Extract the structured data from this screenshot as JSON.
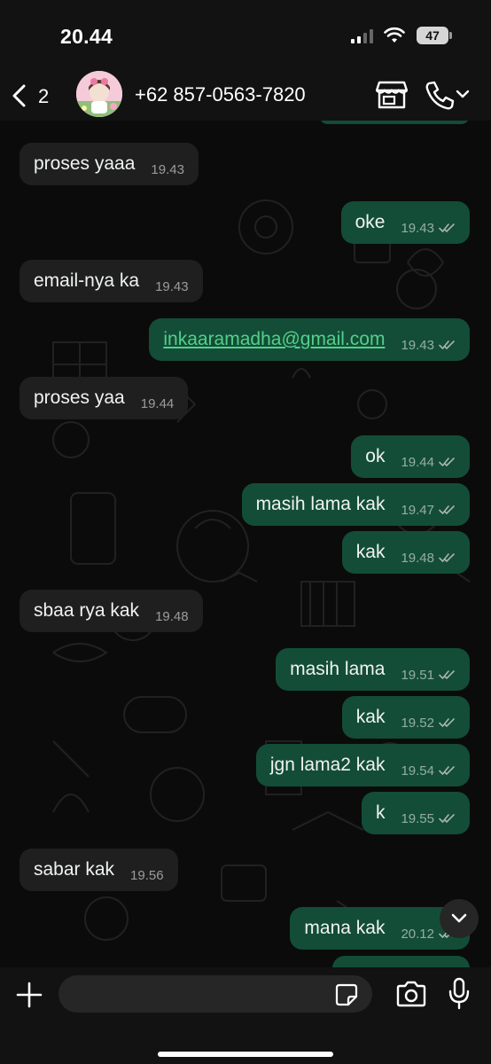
{
  "status_bar": {
    "time": "20.44",
    "battery": "47"
  },
  "header": {
    "back_count": "2",
    "contact_name": "+62 857-0563-7820"
  },
  "messages": [
    {
      "dir": "in",
      "text": "proses yaaa",
      "time": "19.43"
    },
    {
      "dir": "out",
      "text": "oke",
      "time": "19.43"
    },
    {
      "dir": "in",
      "text": "email-nya ka",
      "time": "19.43"
    },
    {
      "dir": "out",
      "text": "inkaaramadha@gmail.com",
      "time": "19.43",
      "link": true
    },
    {
      "dir": "in",
      "text": "proses yaa",
      "time": "19.44"
    },
    {
      "dir": "out",
      "text": "ok",
      "time": "19.44"
    },
    {
      "dir": "out",
      "text": "masih lama kak",
      "time": "19.47"
    },
    {
      "dir": "out",
      "text": "kak",
      "time": "19.48"
    },
    {
      "dir": "in",
      "text": "sbaa rya kak",
      "time": "19.48"
    },
    {
      "dir": "out",
      "text": "masih lama",
      "time": "19.51"
    },
    {
      "dir": "out",
      "text": "kak",
      "time": "19.52"
    },
    {
      "dir": "out",
      "text": "jgn lama2 kak",
      "time": "19.54"
    },
    {
      "dir": "out",
      "text": "k",
      "time": "19.55"
    },
    {
      "dir": "in",
      "text": "sabar kak",
      "time": "19.56"
    },
    {
      "dir": "out",
      "text": "mana kak",
      "time": "20.12"
    }
  ],
  "input": {
    "placeholder": ""
  },
  "colors": {
    "incoming_bubble": "#1f1f1f",
    "outgoing_bubble": "#134d37",
    "link": "#53d08a",
    "read_ticks": "#a9b4b0"
  }
}
